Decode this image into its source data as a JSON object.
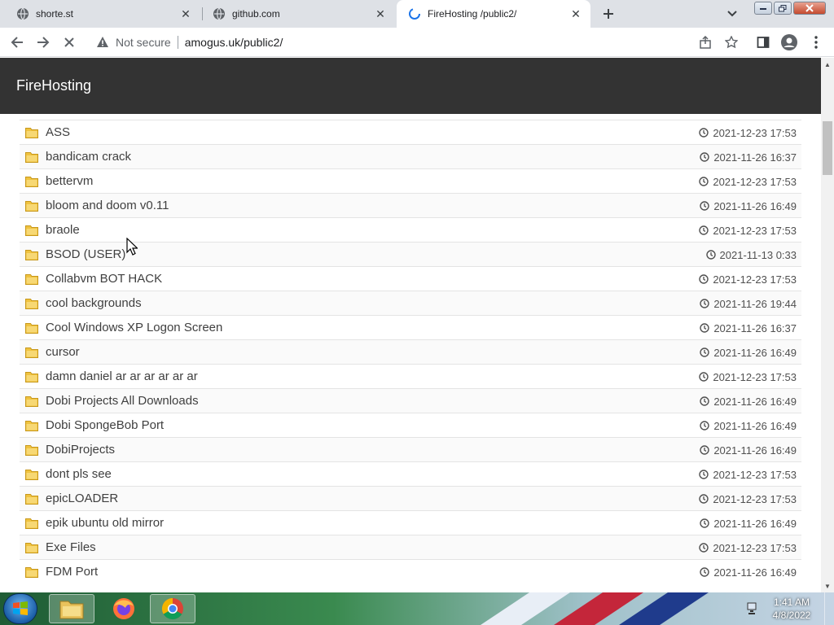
{
  "browser": {
    "tabs": [
      {
        "title": "shorte.st",
        "active": false
      },
      {
        "title": "github.com",
        "active": false
      },
      {
        "title": "FireHosting /public2/",
        "active": true
      }
    ],
    "omnibox": {
      "security_label": "Not secure",
      "url": "amogus.uk/public2/"
    }
  },
  "page": {
    "brand": "FireHosting",
    "entries": [
      {
        "name": "ASS",
        "date": "2021-12-23 17:53"
      },
      {
        "name": "bandicam crack",
        "date": "2021-11-26 16:37"
      },
      {
        "name": "bettervm",
        "date": "2021-12-23 17:53"
      },
      {
        "name": "bloom and doom v0.11",
        "date": "2021-11-26 16:49"
      },
      {
        "name": "braole",
        "date": "2021-12-23 17:53"
      },
      {
        "name": "BSOD (USER)",
        "date": "2021-11-13 0:33"
      },
      {
        "name": "Collabvm BOT HACK",
        "date": "2021-12-23 17:53"
      },
      {
        "name": "cool backgrounds",
        "date": "2021-11-26 19:44"
      },
      {
        "name": "Cool Windows XP Logon Screen",
        "date": "2021-11-26 16:37"
      },
      {
        "name": "cursor",
        "date": "2021-11-26 16:49"
      },
      {
        "name": "damn daniel ar ar ar ar ar ar",
        "date": "2021-12-23 17:53"
      },
      {
        "name": "Dobi Projects All Downloads",
        "date": "2021-11-26 16:49"
      },
      {
        "name": "Dobi SpongeBob Port",
        "date": "2021-11-26 16:49"
      },
      {
        "name": "DobiProjects",
        "date": "2021-11-26 16:49"
      },
      {
        "name": "dont pls see",
        "date": "2021-12-23 17:53"
      },
      {
        "name": "epicLOADER",
        "date": "2021-12-23 17:53"
      },
      {
        "name": "epik ubuntu old mirror",
        "date": "2021-11-26 16:49"
      },
      {
        "name": "Exe Files",
        "date": "2021-12-23 17:53"
      },
      {
        "name": "FDM Port",
        "date": "2021-11-26 16:49"
      }
    ]
  },
  "taskbar": {
    "time": "1:41 AM",
    "date": "4/8/2022"
  },
  "colors": {
    "header_bg": "#333333",
    "folder": "#f0c340",
    "tabstrip": "#dee1e6"
  },
  "icons": {
    "folder": "folder-icon",
    "clock": "clock-icon"
  }
}
